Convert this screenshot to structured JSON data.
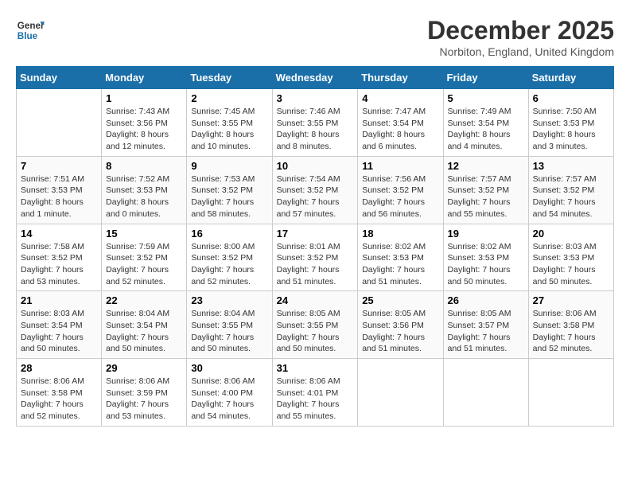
{
  "header": {
    "logo_line1": "General",
    "logo_line2": "Blue",
    "month_title": "December 2025",
    "subtitle": "Norbiton, England, United Kingdom"
  },
  "weekdays": [
    "Sunday",
    "Monday",
    "Tuesday",
    "Wednesday",
    "Thursday",
    "Friday",
    "Saturday"
  ],
  "weeks": [
    [
      {
        "day": "",
        "info": ""
      },
      {
        "day": "1",
        "info": "Sunrise: 7:43 AM\nSunset: 3:56 PM\nDaylight: 8 hours\nand 12 minutes."
      },
      {
        "day": "2",
        "info": "Sunrise: 7:45 AM\nSunset: 3:55 PM\nDaylight: 8 hours\nand 10 minutes."
      },
      {
        "day": "3",
        "info": "Sunrise: 7:46 AM\nSunset: 3:55 PM\nDaylight: 8 hours\nand 8 minutes."
      },
      {
        "day": "4",
        "info": "Sunrise: 7:47 AM\nSunset: 3:54 PM\nDaylight: 8 hours\nand 6 minutes."
      },
      {
        "day": "5",
        "info": "Sunrise: 7:49 AM\nSunset: 3:54 PM\nDaylight: 8 hours\nand 4 minutes."
      },
      {
        "day": "6",
        "info": "Sunrise: 7:50 AM\nSunset: 3:53 PM\nDaylight: 8 hours\nand 3 minutes."
      }
    ],
    [
      {
        "day": "7",
        "info": "Sunrise: 7:51 AM\nSunset: 3:53 PM\nDaylight: 8 hours\nand 1 minute."
      },
      {
        "day": "8",
        "info": "Sunrise: 7:52 AM\nSunset: 3:53 PM\nDaylight: 8 hours\nand 0 minutes."
      },
      {
        "day": "9",
        "info": "Sunrise: 7:53 AM\nSunset: 3:52 PM\nDaylight: 7 hours\nand 58 minutes."
      },
      {
        "day": "10",
        "info": "Sunrise: 7:54 AM\nSunset: 3:52 PM\nDaylight: 7 hours\nand 57 minutes."
      },
      {
        "day": "11",
        "info": "Sunrise: 7:56 AM\nSunset: 3:52 PM\nDaylight: 7 hours\nand 56 minutes."
      },
      {
        "day": "12",
        "info": "Sunrise: 7:57 AM\nSunset: 3:52 PM\nDaylight: 7 hours\nand 55 minutes."
      },
      {
        "day": "13",
        "info": "Sunrise: 7:57 AM\nSunset: 3:52 PM\nDaylight: 7 hours\nand 54 minutes."
      }
    ],
    [
      {
        "day": "14",
        "info": "Sunrise: 7:58 AM\nSunset: 3:52 PM\nDaylight: 7 hours\nand 53 minutes."
      },
      {
        "day": "15",
        "info": "Sunrise: 7:59 AM\nSunset: 3:52 PM\nDaylight: 7 hours\nand 52 minutes."
      },
      {
        "day": "16",
        "info": "Sunrise: 8:00 AM\nSunset: 3:52 PM\nDaylight: 7 hours\nand 52 minutes."
      },
      {
        "day": "17",
        "info": "Sunrise: 8:01 AM\nSunset: 3:52 PM\nDaylight: 7 hours\nand 51 minutes."
      },
      {
        "day": "18",
        "info": "Sunrise: 8:02 AM\nSunset: 3:53 PM\nDaylight: 7 hours\nand 51 minutes."
      },
      {
        "day": "19",
        "info": "Sunrise: 8:02 AM\nSunset: 3:53 PM\nDaylight: 7 hours\nand 50 minutes."
      },
      {
        "day": "20",
        "info": "Sunrise: 8:03 AM\nSunset: 3:53 PM\nDaylight: 7 hours\nand 50 minutes."
      }
    ],
    [
      {
        "day": "21",
        "info": "Sunrise: 8:03 AM\nSunset: 3:54 PM\nDaylight: 7 hours\nand 50 minutes."
      },
      {
        "day": "22",
        "info": "Sunrise: 8:04 AM\nSunset: 3:54 PM\nDaylight: 7 hours\nand 50 minutes."
      },
      {
        "day": "23",
        "info": "Sunrise: 8:04 AM\nSunset: 3:55 PM\nDaylight: 7 hours\nand 50 minutes."
      },
      {
        "day": "24",
        "info": "Sunrise: 8:05 AM\nSunset: 3:55 PM\nDaylight: 7 hours\nand 50 minutes."
      },
      {
        "day": "25",
        "info": "Sunrise: 8:05 AM\nSunset: 3:56 PM\nDaylight: 7 hours\nand 51 minutes."
      },
      {
        "day": "26",
        "info": "Sunrise: 8:05 AM\nSunset: 3:57 PM\nDaylight: 7 hours\nand 51 minutes."
      },
      {
        "day": "27",
        "info": "Sunrise: 8:06 AM\nSunset: 3:58 PM\nDaylight: 7 hours\nand 52 minutes."
      }
    ],
    [
      {
        "day": "28",
        "info": "Sunrise: 8:06 AM\nSunset: 3:58 PM\nDaylight: 7 hours\nand 52 minutes."
      },
      {
        "day": "29",
        "info": "Sunrise: 8:06 AM\nSunset: 3:59 PM\nDaylight: 7 hours\nand 53 minutes."
      },
      {
        "day": "30",
        "info": "Sunrise: 8:06 AM\nSunset: 4:00 PM\nDaylight: 7 hours\nand 54 minutes."
      },
      {
        "day": "31",
        "info": "Sunrise: 8:06 AM\nSunset: 4:01 PM\nDaylight: 7 hours\nand 55 minutes."
      },
      {
        "day": "",
        "info": ""
      },
      {
        "day": "",
        "info": ""
      },
      {
        "day": "",
        "info": ""
      }
    ]
  ]
}
